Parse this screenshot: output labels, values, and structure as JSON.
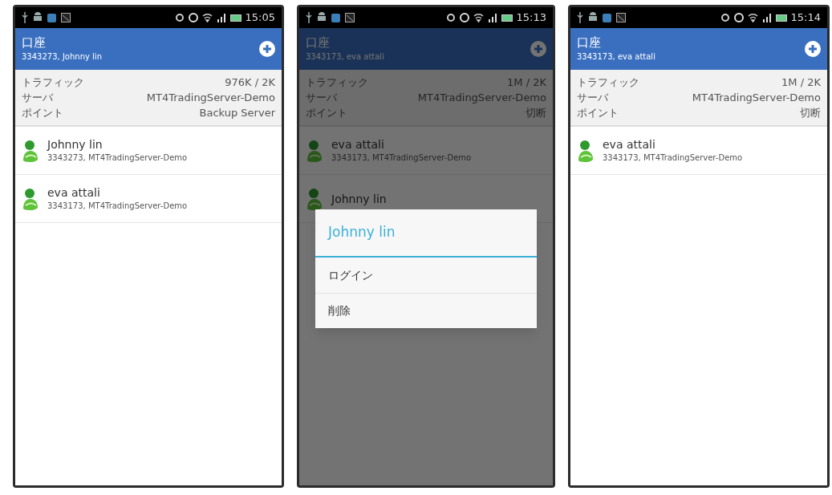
{
  "phones": [
    {
      "status_time": "15:05",
      "title": "口座",
      "subtitle": "3343273, Johnny lin",
      "dimmed": false,
      "info": [
        {
          "label": "トラフィック",
          "value": "976K / 2K"
        },
        {
          "label": "サーバ",
          "value": "MT4TradingServer-Demo"
        },
        {
          "label": "ポイント",
          "value": "Backup Server"
        }
      ],
      "accounts": [
        {
          "name": "Johnny lin",
          "detail": "3343273, MT4TradingServer-Demo"
        },
        {
          "name": "eva attali",
          "detail": "3343173, MT4TradingServer-Demo"
        }
      ]
    },
    {
      "status_time": "15:13",
      "title": "口座",
      "subtitle": "3343173, eva attali",
      "dimmed": true,
      "info": [
        {
          "label": "トラフィック",
          "value": "1M / 2K"
        },
        {
          "label": "サーバ",
          "value": "MT4TradingServer-Demo"
        },
        {
          "label": "ポイント",
          "value": "切断"
        }
      ],
      "accounts": [
        {
          "name": "eva attali",
          "detail": "3343173, MT4TradingServer-Demo"
        },
        {
          "name": "Johnny lin"
        }
      ],
      "dialog": {
        "title": "Johnny lin",
        "items": [
          "ログイン",
          "削除"
        ]
      }
    },
    {
      "status_time": "15:14",
      "title": "口座",
      "subtitle": "3343173, eva attali",
      "dimmed": false,
      "info": [
        {
          "label": "トラフィック",
          "value": "1M / 2K"
        },
        {
          "label": "サーバ",
          "value": "MT4TradingServer-Demo"
        },
        {
          "label": "ポイント",
          "value": "切断"
        }
      ],
      "accounts": [
        {
          "name": "eva attali",
          "detail": "3343173, MT4TradingServer-Demo"
        }
      ]
    }
  ]
}
